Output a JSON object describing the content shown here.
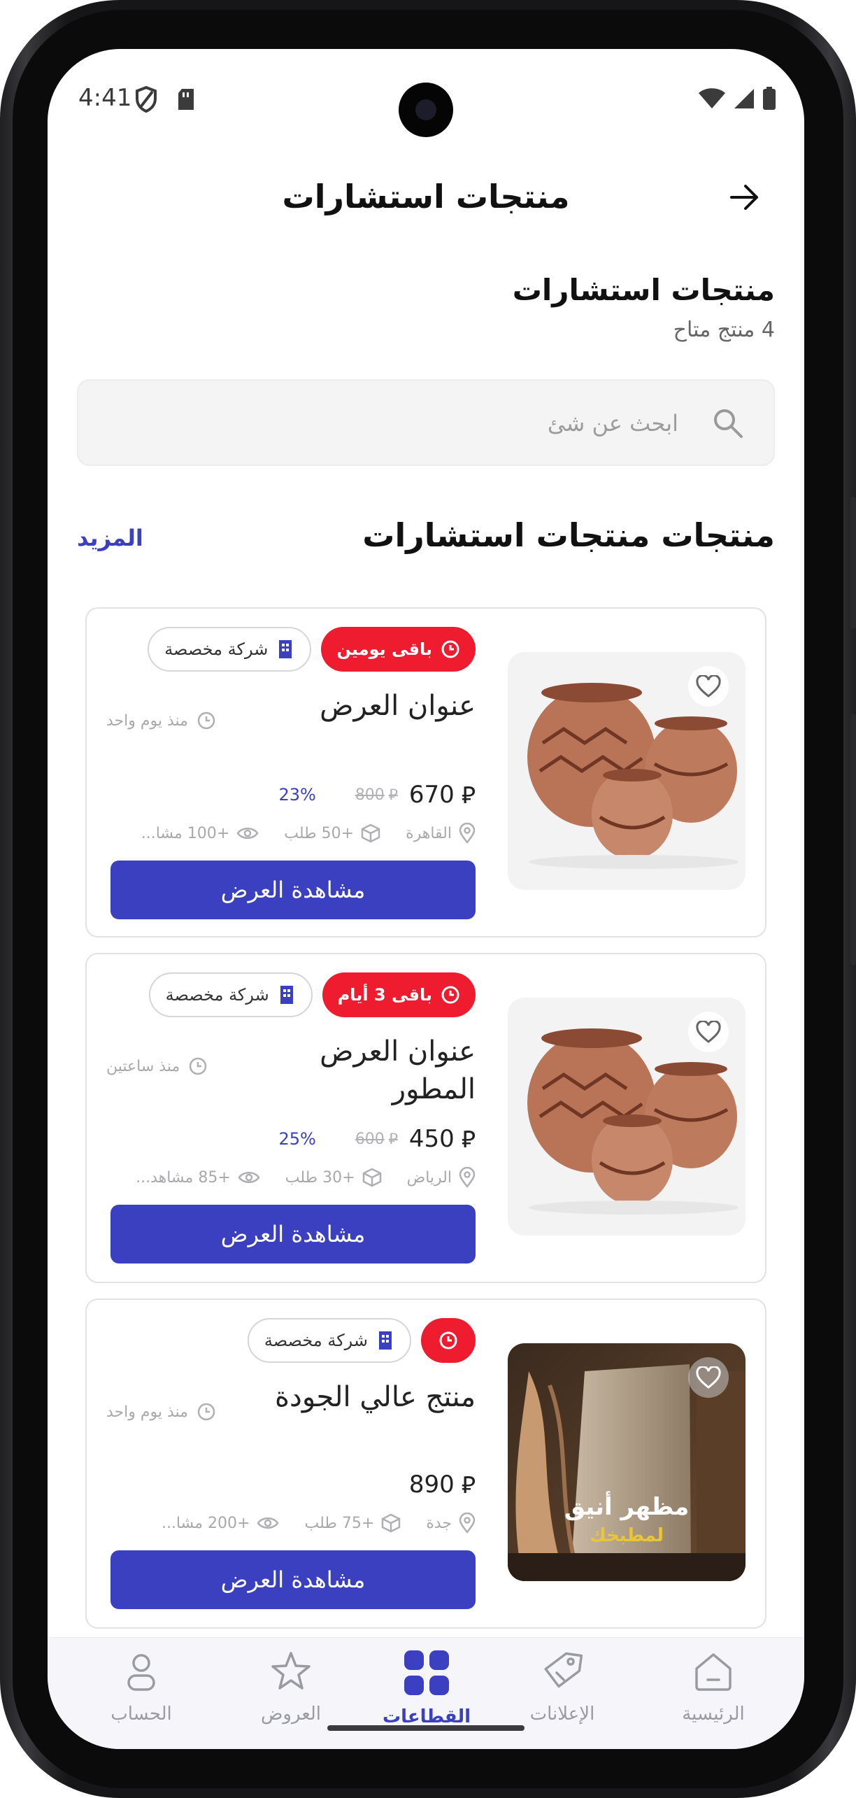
{
  "status_bar": {
    "time": "4:41"
  },
  "app_bar": {
    "title": "منتجات استشارات"
  },
  "header": {
    "title": "منتجات استشارات",
    "count": "4 منتج متاح"
  },
  "search": {
    "placeholder": "ابحث عن شئ"
  },
  "list": {
    "title": "منتجات منتجات استشارات",
    "more_label": "المزيد"
  },
  "cards": [
    {
      "time_chip": "باقى يومين",
      "company_chip": "شركة مخصصة",
      "title": "عنوان العرض",
      "posted": "منذ يوم واحد",
      "price": "670",
      "old_price": "800",
      "discount": "23%",
      "location": "القاهرة",
      "orders": "+50 طلب",
      "views": "+100 مشا...",
      "cta": "مشاهدة العرض",
      "image": "pottery"
    },
    {
      "time_chip": "باقى 3 أيام",
      "company_chip": "شركة مخصصة",
      "title": "عنوان العرض المطور",
      "posted": "منذ ساعتين",
      "price": "450",
      "old_price": "600",
      "discount": "25%",
      "location": "الرياض",
      "orders": "+30 طلب",
      "views": "+85 مشاهد...",
      "cta": "مشاهدة العرض",
      "image": "pottery"
    },
    {
      "time_chip": "",
      "company_chip": "شركة مخصصة",
      "title": "منتج عالي الجودة",
      "posted": "منذ يوم واحد",
      "price": "890",
      "location": "جدة",
      "orders": "+75 طلب",
      "views": "+200 مشا...",
      "cta": "مشاهدة العرض",
      "image": "kitchen",
      "image_caption_line1": "مظهر أنيق",
      "image_caption_line2": "لمطبخك"
    }
  ],
  "bottom_nav": [
    {
      "label": "الرئيسية",
      "icon": "home-icon",
      "active": false
    },
    {
      "label": "الإعلانات",
      "icon": "tag-icon",
      "active": false
    },
    {
      "label": "القطاعات",
      "icon": "grid-icon",
      "active": true
    },
    {
      "label": "العروض",
      "icon": "star-icon",
      "active": false
    },
    {
      "label": "الحساب",
      "icon": "person-icon",
      "active": false
    }
  ],
  "colors": {
    "primary": "#3a40bf",
    "badge_red": "#ee1c2e",
    "muted": "#a9a9ad"
  }
}
